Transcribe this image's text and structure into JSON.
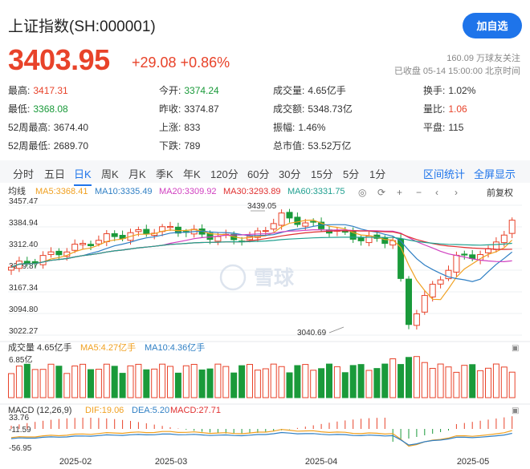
{
  "header": {
    "title": "上证指数(SH:000001)",
    "follow_button": "加自选",
    "price": "3403.95",
    "change": "+29.08 +0.86%",
    "follow_count": "160.09 万球友关注",
    "status": "已收盘 05-14 15:00:00 北京时间"
  },
  "stats": [
    {
      "label": "最高:",
      "value": "3417.31",
      "tone": "red"
    },
    {
      "label": "今开:",
      "value": "3374.24",
      "tone": "green"
    },
    {
      "label": "成交量:",
      "value": "4.65亿手",
      "tone": ""
    },
    {
      "label": "换手:",
      "value": "1.02%",
      "tone": ""
    },
    {
      "label": "最低:",
      "value": "3368.08",
      "tone": "green"
    },
    {
      "label": "昨收:",
      "value": "3374.87",
      "tone": ""
    },
    {
      "label": "成交额:",
      "value": "5348.73亿",
      "tone": ""
    },
    {
      "label": "量比:",
      "value": "1.06",
      "tone": "red"
    },
    {
      "label": "52周最高:",
      "value": "3674.40",
      "tone": ""
    },
    {
      "label": "上涨:",
      "value": "833",
      "tone": ""
    },
    {
      "label": "振幅:",
      "value": "1.46%",
      "tone": ""
    },
    {
      "label": "平盘:",
      "value": "115",
      "tone": ""
    },
    {
      "label": "52周最低:",
      "value": "2689.70",
      "tone": ""
    },
    {
      "label": "下跌:",
      "value": "789",
      "tone": ""
    },
    {
      "label": "总市值:",
      "value": "53.52万亿",
      "tone": ""
    }
  ],
  "tabs": [
    "分时",
    "五日",
    "日K",
    "周K",
    "月K",
    "季K",
    "年K",
    "120分",
    "60分",
    "30分",
    "15分",
    "5分",
    "1分"
  ],
  "active_tab": "日K",
  "tab_actions": [
    "区间统计",
    "全屏显示"
  ],
  "kline": {
    "label": "均线",
    "ma": [
      {
        "text": "MA5:3368.41",
        "color": "#f0a020"
      },
      {
        "text": "MA10:3335.49",
        "color": "#2f7fc4"
      },
      {
        "text": "MA20:3309.92",
        "color": "#d040c0"
      },
      {
        "text": "MA30:3293.89",
        "color": "#e03030"
      },
      {
        "text": "MA60:3331.75",
        "color": "#20a090"
      }
    ],
    "adjust": "前复权",
    "y_ticks": [
      "3457.47",
      "3384.94",
      "3312.40",
      "3239.87",
      "3167.34",
      "3094.80",
      "3022.27"
    ],
    "high_label": "3439.05",
    "low_label": "3040.69"
  },
  "volume": {
    "label": "成交量 4.65亿手",
    "ma5": "MA5:4.27亿手",
    "ma10": "MA10:4.36亿手",
    "ma5_color": "#f0a020",
    "ma10_color": "#2f7fc4",
    "y_tick": "6.85亿"
  },
  "macd": {
    "label": "MACD (12,26,9)",
    "dif": "DIF:19.06",
    "dea": "DEA:5.20",
    "macd": "MACD:27.71",
    "dif_color": "#f0a020",
    "dea_color": "#2f7fc4",
    "macd_color": "#e03030",
    "y_ticks": [
      "33.76",
      "-11.59",
      "-56.95"
    ]
  },
  "x_labels": [
    "2025-02",
    "2025-03",
    "2025-04",
    "2025-05"
  ],
  "watermark": "雪球",
  "colors": {
    "up": "#e8432a",
    "down": "#1a9a3a",
    "accent": "#1e74ea"
  }
}
